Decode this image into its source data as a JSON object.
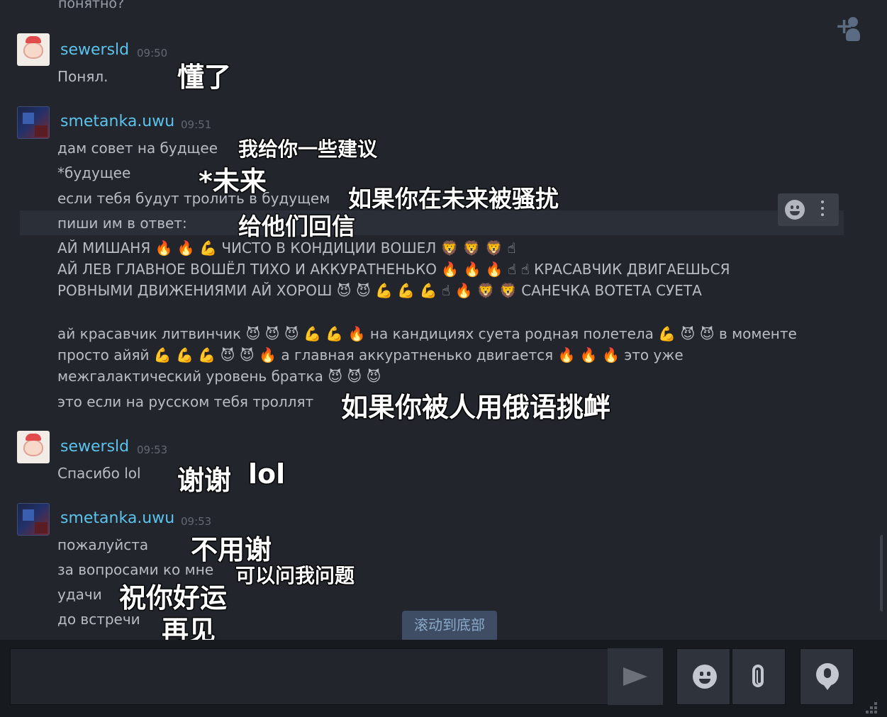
{
  "chat": {
    "partial_top_line": "понятно?",
    "messages": [
      {
        "author": "sewersld",
        "time": "09:50",
        "lines": [
          "Понял."
        ],
        "translations": [
          "懂了"
        ]
      },
      {
        "author": "smetanka.uwu",
        "time": "09:51",
        "lines": [
          "дам совет на будщее",
          "*будущее",
          "если тебя будут тролить в будущем",
          "пиши им в ответ:",
          "АЙ МИШАНЯ 🔥 🔥 💪 ЧИСТО В КОНДИЦИИ ВОШЕЛ 🦁 🦁 🦁 ☝",
          "АЙ ЛЕВ ГЛАВНОЕ ВОШЁЛ ТИХО И АККУРАТНЕНЬКО 🔥 🔥 🔥 ☝ ☝ КРАСАВЧИК ДВИГАЕШЬСЯ",
          "РОВНЫМИ ДВИЖЕНИЯМИ АЙ ХОРОШ 😈 😈 💪 💪 💪 ☝ 🔥 🦁 🦁 САНЕЧКА ВОТЕТА СУЕТА",
          "ай красавчик литвинчик 😈 😈 😈 💪 💪 🔥 на кандициях суета родная полетела 💪 😈 😈 в моменте",
          "просто айяй 💪 💪 💪 😈 😈 🔥 а главная аккуратненько двигается 🔥 🔥 🔥 это уже",
          "межгалактический уровень братка 😈 😈 😈",
          "это если на русском тебя троллят"
        ],
        "translations": [
          "我给你一些建议",
          "*未来",
          "如果你在未来被骚扰",
          "给他们回信",
          "如果你被人用俄语挑衅"
        ]
      },
      {
        "author": "sewersld",
        "time": "09:53",
        "lines": [
          "Спасибо lol"
        ],
        "translations": [
          "谢谢",
          "lol"
        ]
      },
      {
        "author": "smetanka.uwu",
        "time": "09:53",
        "lines": [
          "пожалуйста",
          "за вопросами ко мне",
          "удачи",
          "до встречи"
        ],
        "translations": [
          "不用谢",
          "可以问我问题",
          "祝你好运",
          "再见"
        ]
      }
    ],
    "scroll_to_bottom_label": "滚动到底部"
  },
  "composer": {
    "input_value": "",
    "send_icon": "send-arrow-icon",
    "emoji_icon": "smiley-icon",
    "attach_icon": "paperclip-icon",
    "voice_icon": "microphone-icon"
  },
  "colors": {
    "background": "#22252b",
    "username": "#5cc3ee",
    "message_text": "#b8bcc3",
    "timestamp": "#626873",
    "composer_background": "#171a1f"
  }
}
